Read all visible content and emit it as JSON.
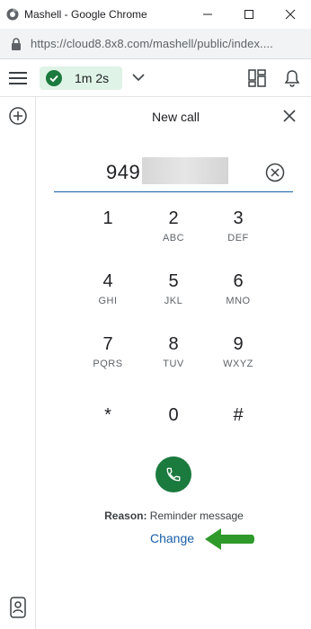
{
  "browser": {
    "window_title": "Mashell - Google Chrome",
    "url": "https://cloud8.8x8.com/mashell/public/index...."
  },
  "header": {
    "call_timer": "1m 2s",
    "status_color": "#1b7a3e"
  },
  "icons": {
    "menu": "hamburger-icon",
    "status": "check-circle-icon",
    "dropdown": "chevron-down-icon",
    "layout": "layout-icon",
    "notifications": "bell-icon",
    "add": "plus-circle-icon",
    "contacts": "contacts-icon",
    "close": "close-icon",
    "clear": "clear-circle-icon",
    "call": "phone-icon"
  },
  "panel": {
    "title": "New call",
    "phone_value": "949"
  },
  "dialpad": {
    "keys": [
      {
        "digit": "1",
        "letters": ""
      },
      {
        "digit": "2",
        "letters": "ABC"
      },
      {
        "digit": "3",
        "letters": "DEF"
      },
      {
        "digit": "4",
        "letters": "GHI"
      },
      {
        "digit": "5",
        "letters": "JKL"
      },
      {
        "digit": "6",
        "letters": "MNO"
      },
      {
        "digit": "7",
        "letters": "PQRS"
      },
      {
        "digit": "8",
        "letters": "TUV"
      },
      {
        "digit": "9",
        "letters": "WXYZ"
      },
      {
        "digit": "*",
        "letters": ""
      },
      {
        "digit": "0",
        "letters": ""
      },
      {
        "digit": "#",
        "letters": ""
      }
    ]
  },
  "reason": {
    "label": "Reason:",
    "value": " Reminder message",
    "change_link": "Change"
  },
  "colors": {
    "accent_blue": "#1a5ea8",
    "call_green": "#1b7a3e",
    "arrow_green": "#2e9a2a",
    "status_pill_bg": "#dff3e6"
  }
}
